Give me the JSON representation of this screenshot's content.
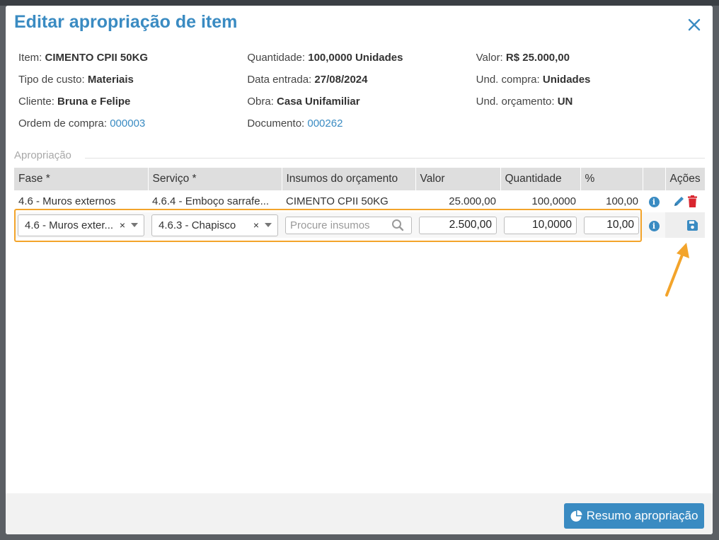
{
  "modal": {
    "title": "Editar apropriação de item"
  },
  "details": {
    "item_label": "Item:",
    "item_value": "CIMENTO CPII 50KG",
    "quantidade_label": "Quantidade:",
    "quantidade_value": "100,0000 Unidades",
    "valor_label": "Valor:",
    "valor_value": "R$ 25.000,00",
    "tipo_custo_label": "Tipo de custo:",
    "tipo_custo_value": "Materiais",
    "data_entrada_label": "Data entrada:",
    "data_entrada_value": "27/08/2024",
    "und_compra_label": "Und. compra:",
    "und_compra_value": "Unidades",
    "cliente_label": "Cliente:",
    "cliente_value": "Bruna e Felipe",
    "obra_label": "Obra:",
    "obra_value": "Casa Unifamiliar",
    "und_orcamento_label": "Und. orçamento:",
    "und_orcamento_value": "UN",
    "ordem_compra_label": "Ordem de compra:",
    "ordem_compra_value": "000003",
    "documento_label": "Documento:",
    "documento_value": "000262"
  },
  "apropriacao": {
    "section_label": "Apropriação",
    "columns": [
      "Fase *",
      "Serviço *",
      "Insumos do orçamento",
      "Valor",
      "Quantidade",
      "%",
      "",
      "Ações"
    ],
    "rows": [
      {
        "fase": "4.6 - Muros externos",
        "servico": "4.6.4 - Emboço sarrafe...",
        "insumo": "CIMENTO CPII 50KG",
        "valor": "25.000,00",
        "quantidade": "100,0000",
        "percent": "100,00"
      }
    ],
    "edit_row": {
      "fase": "4.6 - Muros exter...",
      "servico": "4.6.3 - Chapisco",
      "insumo_placeholder": "Procure insumos",
      "valor": "2.500,00",
      "quantidade": "10,0000",
      "percent": "10,00",
      "clear_glyph": "×"
    },
    "info_glyph": "i"
  },
  "footer": {
    "summary_button": "Resumo apropriação"
  },
  "colors": {
    "accent": "#3a8bc2",
    "highlight": "#f3a42b",
    "delete": "#d9262f"
  }
}
